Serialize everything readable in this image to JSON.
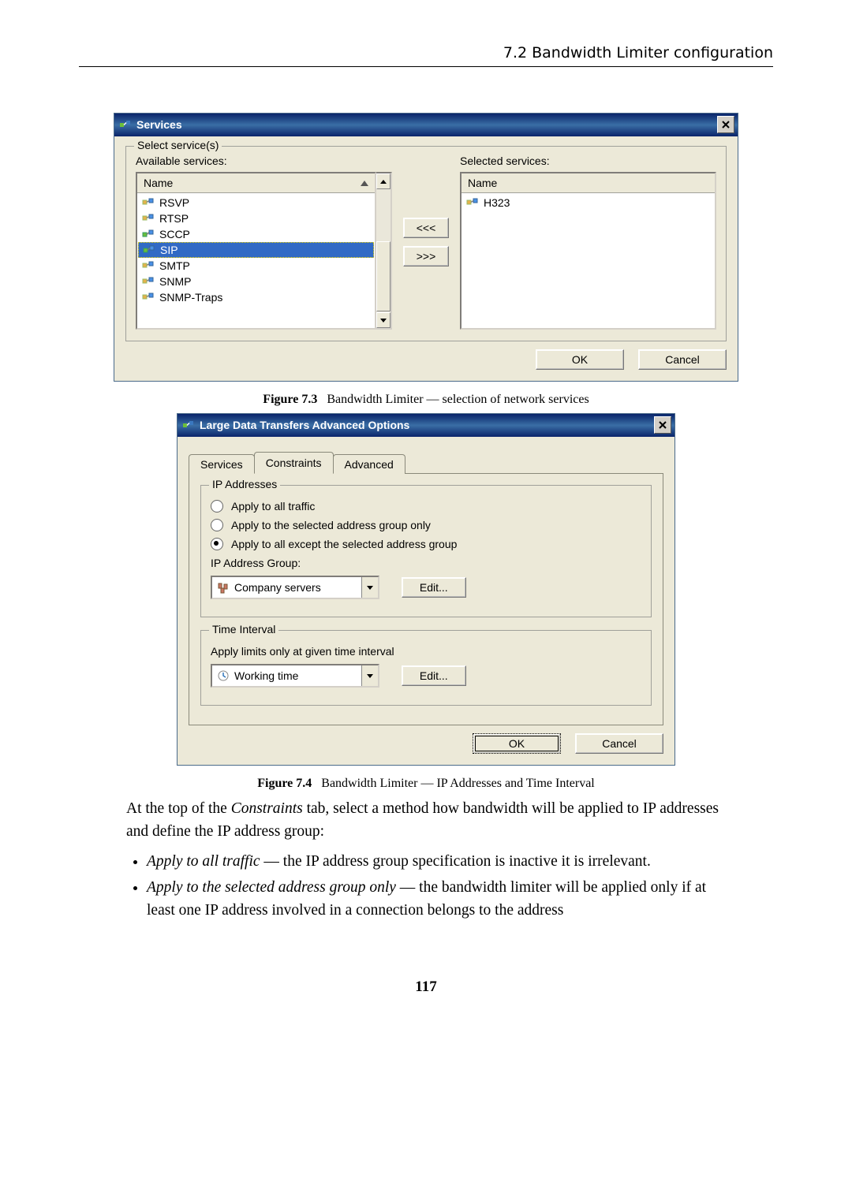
{
  "header": "7.2  Bandwidth Limiter configuration",
  "fig73": {
    "title": "Services",
    "fieldset": "Select service(s)",
    "available_label": "Available services:",
    "selected_label": "Selected services:",
    "col_header": "Name",
    "available_items": [
      "RSVP",
      "RTSP",
      "SCCP",
      "SIP",
      "SMTP",
      "SNMP",
      "SNMP-Traps"
    ],
    "sel_highlight_index": 3,
    "selected_items": [
      "H323"
    ],
    "btn_add": "<<<",
    "btn_remove": ">>>",
    "ok": "OK",
    "cancel": "Cancel",
    "caption_bold": "Figure 7.3",
    "caption_rest": "Bandwidth Limiter — selection of network services"
  },
  "fig74": {
    "title": "Large Data Transfers Advanced Options",
    "tabs": [
      "Services",
      "Constraints",
      "Advanced"
    ],
    "active_tab": 1,
    "group_ip": "IP Addresses",
    "radio1": "Apply to all traffic",
    "radio2": "Apply to the selected address group only",
    "radio3": "Apply to all except the selected address group",
    "checked_radio": 2,
    "ip_group_label": "IP Address Group:",
    "ip_group_value": "Company servers",
    "edit": "Edit...",
    "group_time": "Time Interval",
    "time_desc": "Apply limits only at given time interval",
    "time_value": "Working time",
    "ok": "OK",
    "cancel": "Cancel",
    "caption_bold": "Figure 7.4",
    "caption_rest": "Bandwidth Limiter — IP Addresses and Time Interval"
  },
  "body": {
    "para": "At the top of the Constraints tab, select a method how bandwidth will be applied to IP addresses and define the IP address group:",
    "bullet1_it": "Apply to all traffic",
    "bullet1_rest": " — the IP address group specification is inactive it is irrelevant.",
    "bullet2_it": "Apply to the selected address group only",
    "bullet2_rest": " — the bandwidth limiter will be applied only if at least one IP address involved in a connection belongs to the address"
  },
  "page_number": "117"
}
